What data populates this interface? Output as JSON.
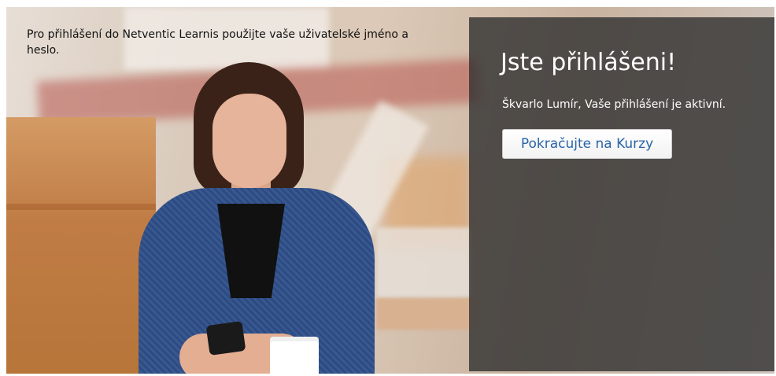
{
  "intro": {
    "text": "Pro přihlášení do Netventic Learnis použijte vaše uživatelské jméno a heslo."
  },
  "login_panel": {
    "title": "Jste přihlášeni!",
    "status": "Škvarlo Lumír, Vaše přihlášení je aktivní.",
    "continue_label": "Pokračujte na Kurzy"
  },
  "colors": {
    "panel_bg": "#303030",
    "button_text": "#2a64a8",
    "jacket": "#2f4f8a"
  }
}
